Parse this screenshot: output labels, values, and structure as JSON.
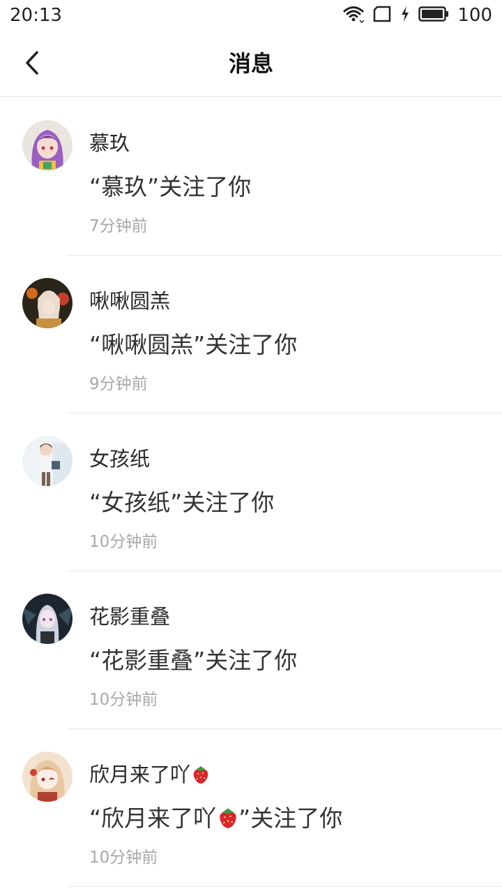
{
  "status_bar": {
    "time": "20:13",
    "battery": "100",
    "icons": [
      "wifi-icon",
      "sim-card-icon",
      "charging-icon",
      "battery-icon"
    ]
  },
  "header": {
    "back_icon": "chevron-left-icon",
    "title": "消息"
  },
  "messages": [
    {
      "name": "慕玖",
      "message": "“慕玖”关注了你",
      "time": "7分钟前",
      "avatar_colors": [
        "#e8d6f0",
        "#9b5fc0"
      ]
    },
    {
      "name": "啾啾圆羔",
      "message": "“啾啾圆羔”关注了你",
      "time": "9分钟前",
      "avatar_colors": [
        "#2b2418",
        "#e0b070"
      ]
    },
    {
      "name": "女孩纸",
      "message": "“女孩纸”关注了你",
      "time": "10分钟前",
      "avatar_colors": [
        "#eef3f6",
        "#7a6050"
      ]
    },
    {
      "name": "花影重叠",
      "message": "“花影重叠”关注了你",
      "time": "10分钟前",
      "avatar_colors": [
        "#1d2630",
        "#cfd2e0"
      ]
    },
    {
      "name": "欣月来了吖",
      "message_prefix": "“欣月来了吖",
      "message_suffix": "”关注了你",
      "time": "10分钟前",
      "name_emoji": "strawberry-icon",
      "avatar_colors": [
        "#f4e2d0",
        "#d9a070"
      ]
    }
  ]
}
